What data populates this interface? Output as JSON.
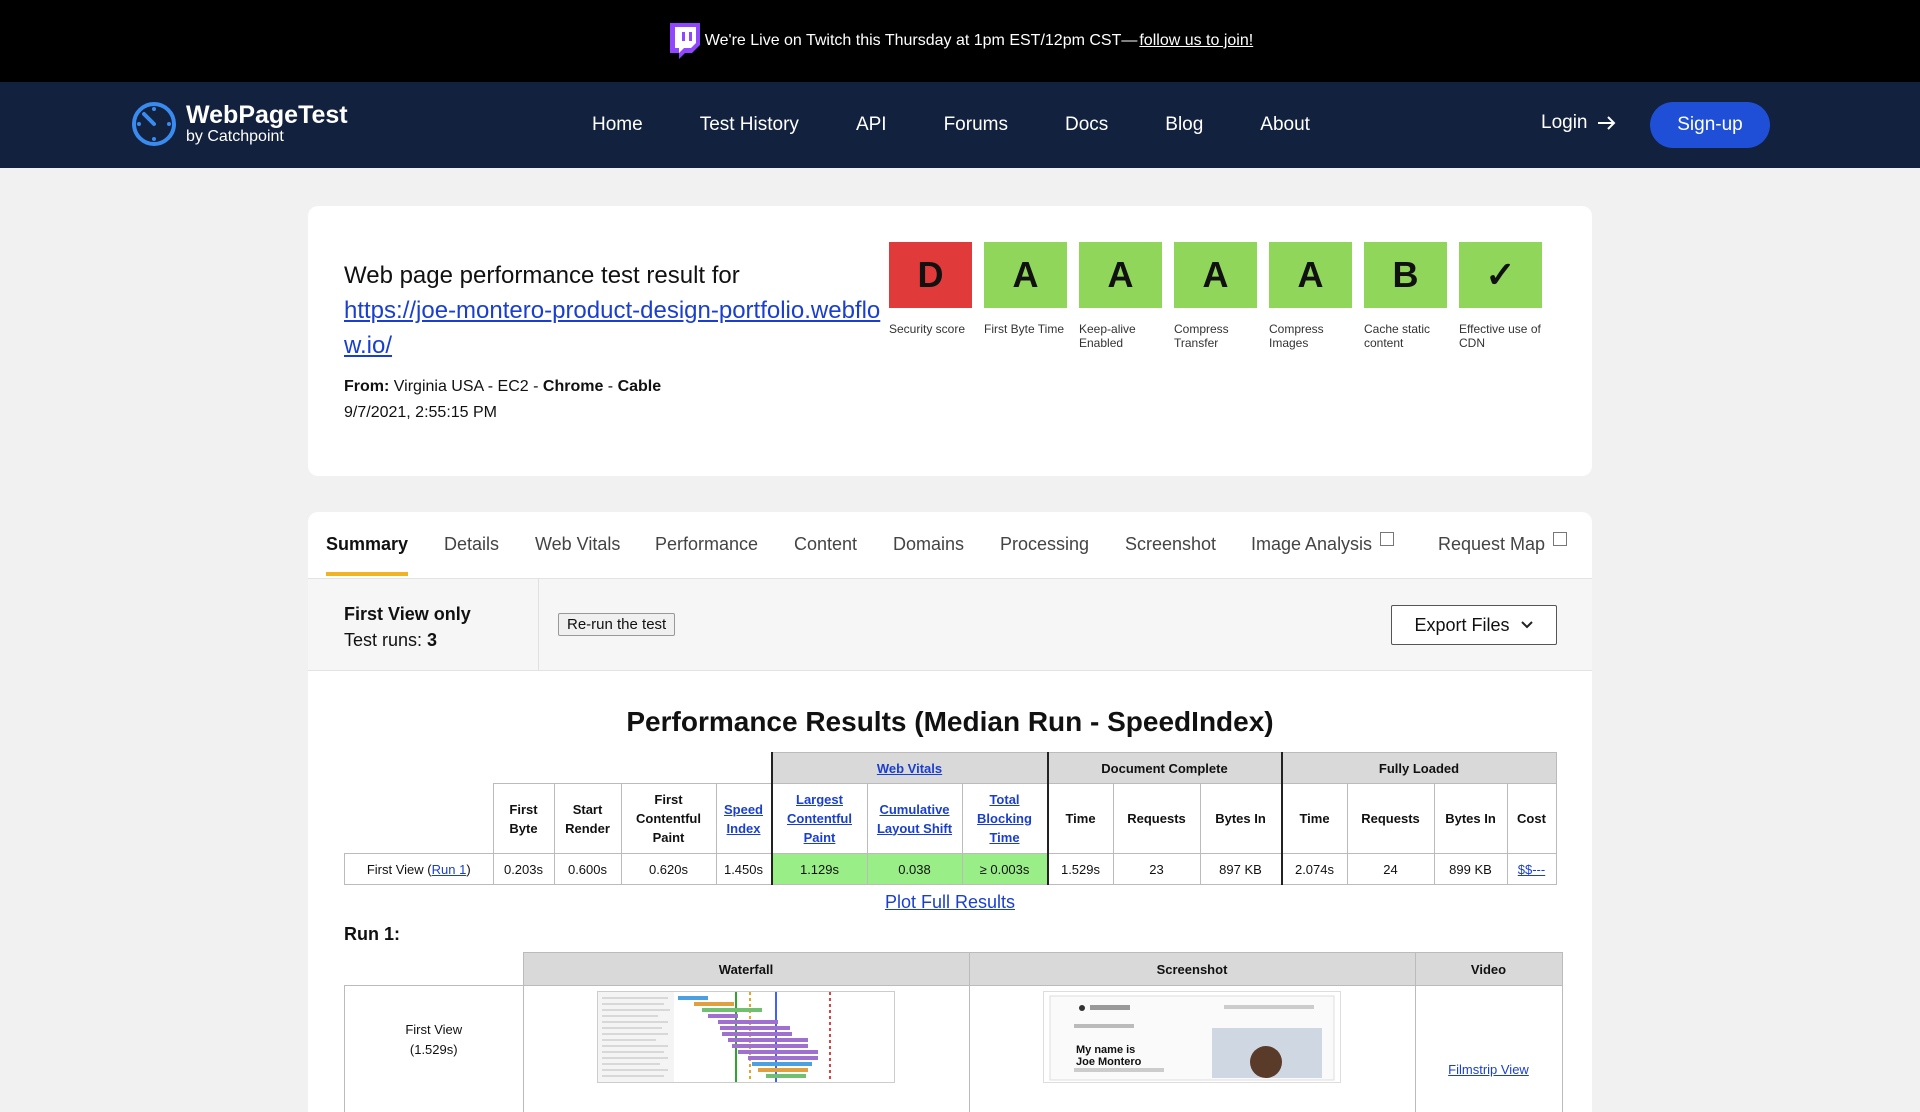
{
  "banner": {
    "text": "We're Live on Twitch this Thursday at 1pm EST/12pm CST—",
    "link": "follow us to join!"
  },
  "logo": {
    "title": "WebPageTest",
    "subtitle": "by Catchpoint"
  },
  "nav": {
    "items": [
      "Home",
      "Test History",
      "API",
      "Forums",
      "Docs",
      "Blog",
      "About"
    ],
    "login": "Login",
    "signup": "Sign-up"
  },
  "header": {
    "title": "Web page performance test result for",
    "url": "https://joe-montero-product-design-portfolio.webflow.io/",
    "from_label": "From:",
    "location": "Virginia USA - EC2 -",
    "browser": "Chrome",
    "sep": "-",
    "connection": "Cable",
    "date": "9/7/2021, 2:55:15 PM"
  },
  "grades": [
    {
      "grade": "D",
      "label": "Security score",
      "color": "#e03a3a"
    },
    {
      "grade": "A",
      "label": "First Byte Time",
      "color": "#8fd65a"
    },
    {
      "grade": "A",
      "label": "Keep-alive Enabled",
      "color": "#8fd65a"
    },
    {
      "grade": "A",
      "label": "Compress Transfer",
      "color": "#8fd65a"
    },
    {
      "grade": "A",
      "label": "Compress Images",
      "color": "#8fd65a"
    },
    {
      "grade": "B",
      "label": "Cache static content",
      "color": "#8fd65a"
    },
    {
      "grade": "✓",
      "label": "Effective use of CDN",
      "color": "#8fd65a"
    }
  ],
  "tabs": [
    "Summary",
    "Details",
    "Web Vitals",
    "Performance",
    "Content",
    "Domains",
    "Processing",
    "Screenshot",
    "Image Analysis",
    "Request Map"
  ],
  "info": {
    "view": "First View only",
    "runs_label": "Test runs:",
    "runs": "3",
    "rerun": "Re-run the test",
    "export": "Export Files"
  },
  "results": {
    "title": "Performance Results (Median Run - SpeedIndex)",
    "groups": {
      "web_vitals": "Web Vitals",
      "document_complete": "Document Complete",
      "fully_loaded": "Fully Loaded"
    },
    "headers": {
      "first_byte": "First Byte",
      "start_render": "Start Render",
      "fcp": "First Contentful Paint",
      "speed_index": "Speed Index",
      "lcp": "Largest Contentful Paint",
      "cls": "Cumulative Layout Shift",
      "tbt": "Total Blocking Time",
      "dc_time": "Time",
      "dc_requests": "Requests",
      "dc_bytes": "Bytes In",
      "fl_time": "Time",
      "fl_requests": "Requests",
      "fl_bytes": "Bytes In",
      "cost": "Cost"
    },
    "row": {
      "label": "First View (",
      "run_link": "Run 1",
      "label_end": ")",
      "first_byte": "0.203s",
      "start_render": "0.600s",
      "fcp": "0.620s",
      "speed_index": "1.450s",
      "lcp": "1.129s",
      "cls": "0.038",
      "tbt": "≥ 0.003s",
      "dc_time": "1.529s",
      "dc_requests": "23",
      "dc_bytes": "897 KB",
      "fl_time": "2.074s",
      "fl_requests": "24",
      "fl_bytes": "899 KB",
      "cost": "$$---"
    },
    "plot_link": "Plot Full Results"
  },
  "run": {
    "title": "Run 1:",
    "headers": {
      "waterfall": "Waterfall",
      "screenshot": "Screenshot",
      "video": "Video"
    },
    "view_label": "First View",
    "view_time": "(1.529s)",
    "screenshot_name": "My name is Joe Montero",
    "video_link": "Filmstrip View"
  }
}
